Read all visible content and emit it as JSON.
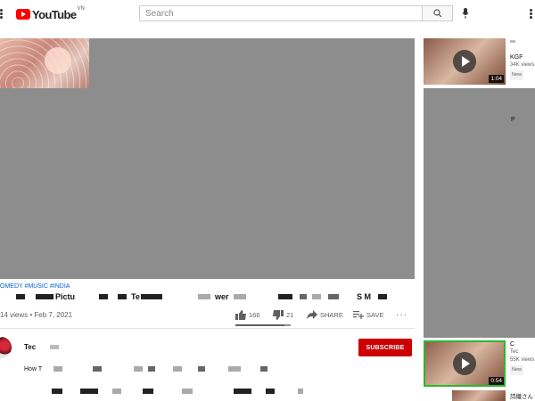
{
  "header": {
    "logo_text": "YouTube",
    "logo_region": "VN",
    "search_placeholder": "Search",
    "icons": [
      "menu-icon",
      "search-icon",
      "mic-icon",
      "more-vert-icon"
    ]
  },
  "video": {
    "hashtags": "OMEDY #MUSIC #INDIA",
    "title_fragments": [
      "Pictu",
      "Te",
      "wer",
      "S M"
    ],
    "views_date": "14 views • Feb 7, 2021",
    "likes": "166",
    "dislikes": "21",
    "share_label": "SHARE",
    "save_label": "SAVE",
    "like_ratio": 0.89
  },
  "channel": {
    "name": "Tec",
    "subscribe_label": "SUBSCRIBE",
    "description_prefix": "How T"
  },
  "sidebar": {
    "items": [
      {
        "duration": "1:04",
        "title": "KGF",
        "views": "34K views",
        "badge": "New"
      },
      {
        "duration": "0:54",
        "title": "Tec",
        "views": "55K views",
        "badge": "New"
      },
      {
        "title": "詩織さん"
      }
    ],
    "partial_labels": [
      "P",
      "C"
    ]
  },
  "colors": {
    "brand_red": "#ff0000",
    "subscribe_red": "#cc0000",
    "player_gray": "#8d8d8d",
    "highlight_green": "#2bb82b",
    "link_blue": "#065fd4"
  }
}
